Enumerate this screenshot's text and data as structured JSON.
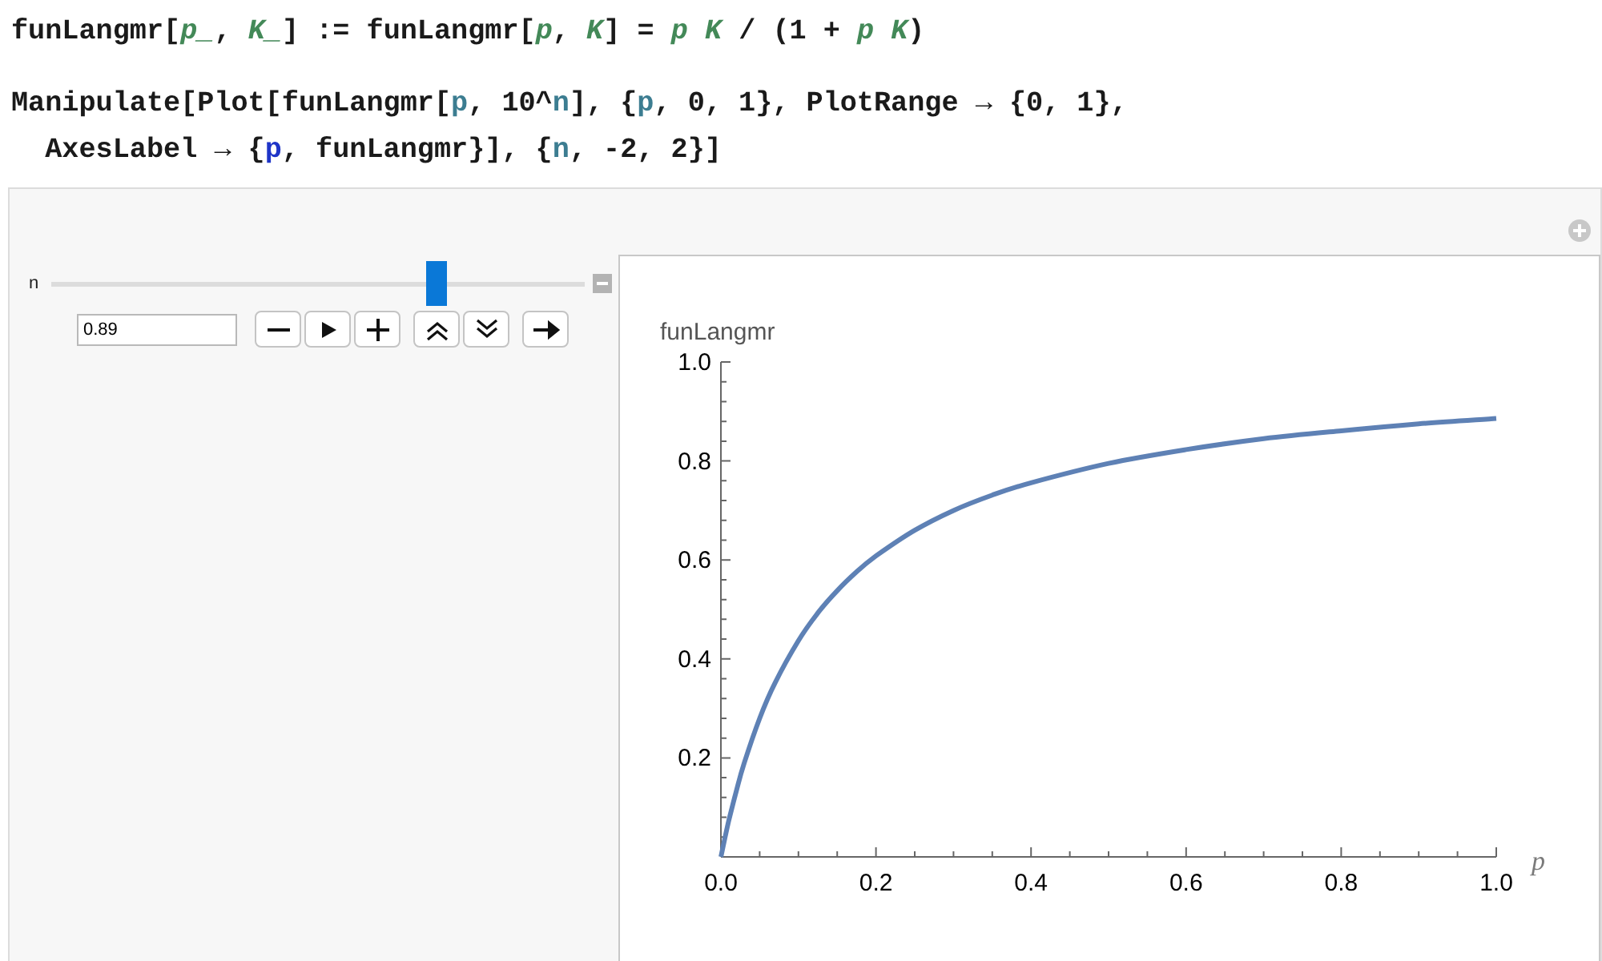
{
  "code_lines": [
    [
      {
        "t": "funLangmr[",
        "kind": "plain"
      },
      {
        "t": "p_",
        "kind": "pattern"
      },
      {
        "t": ", ",
        "kind": "plain"
      },
      {
        "t": "K_",
        "kind": "pattern"
      },
      {
        "t": "] := funLangmr[",
        "kind": "plain"
      },
      {
        "t": "p",
        "kind": "pattern"
      },
      {
        "t": ", ",
        "kind": "plain"
      },
      {
        "t": "K",
        "kind": "pattern"
      },
      {
        "t": "] = ",
        "kind": "plain"
      },
      {
        "t": "p K",
        "kind": "pattern"
      },
      {
        "t": " / (1 + ",
        "kind": "plain"
      },
      {
        "t": "p K",
        "kind": "pattern"
      },
      {
        "t": ")",
        "kind": "plain"
      }
    ],
    [
      {
        "t": "Manipulate[Plot[funLangmr[",
        "kind": "plain"
      },
      {
        "t": "p",
        "kind": "scoped"
      },
      {
        "t": ", 10^",
        "kind": "plain"
      },
      {
        "t": "n",
        "kind": "scoped"
      },
      {
        "t": "], {",
        "kind": "plain"
      },
      {
        "t": "p",
        "kind": "scoped"
      },
      {
        "t": ", 0, 1}, PlotRange → {0, 1},",
        "kind": "plain"
      }
    ],
    [
      {
        "t": "  AxesLabel → {",
        "kind": "plain"
      },
      {
        "t": "p",
        "kind": "unscoped"
      },
      {
        "t": ", funLangmr}], {",
        "kind": "plain"
      },
      {
        "t": "n",
        "kind": "scoped"
      },
      {
        "t": ", -2, 2}]",
        "kind": "plain"
      }
    ]
  ],
  "manipulate": {
    "slider": {
      "label": "n",
      "level": 0.72,
      "value": "0.89"
    },
    "controls": [
      {
        "kind": "minus"
      },
      {
        "kind": "play"
      },
      {
        "kind": "plus"
      },
      {
        "kind": "faster"
      },
      {
        "kind": "slower"
      },
      {
        "kind": "direction"
      }
    ],
    "plot": {
      "chart_data": {
        "type": "line",
        "xlabel": "p",
        "ylabel": "funLangmr",
        "x": [
          0,
          0.01,
          0.02,
          0.03,
          0.05,
          0.07,
          0.1,
          0.125,
          0.15,
          0.175,
          0.2,
          0.25,
          0.3,
          0.35,
          0.4,
          0.5,
          0.6,
          0.7,
          0.8,
          0.9,
          1.0
        ],
        "series": [
          {
            "color": "#5e81b5",
            "values": [
              0,
              0.072,
              0.134,
              0.189,
              0.28,
              0.352,
              0.437,
              0.493,
              0.538,
              0.576,
              0.608,
              0.66,
              0.7,
              0.731,
              0.756,
              0.795,
              0.823,
              0.845,
              0.861,
              0.875,
              0.886
            ]
          }
        ],
        "xlim": [
          0,
          1
        ],
        "ylim": [
          0,
          1
        ],
        "xticks": [
          {
            "value": 0,
            "label": "0.0"
          },
          {
            "value": 0.2,
            "label": "0.2"
          },
          {
            "value": 0.4,
            "label": "0.4"
          },
          {
            "value": 0.6,
            "label": "0.6"
          },
          {
            "value": 0.8,
            "label": "0.8"
          },
          {
            "value": 1,
            "label": "1.0"
          }
        ],
        "yticks": [
          {
            "value": 0.2,
            "label": "0.2"
          },
          {
            "value": 0.4,
            "label": "0.4"
          },
          {
            "value": 0.6,
            "label": "0.6"
          },
          {
            "value": 0.8,
            "label": "0.8"
          },
          {
            "value": 1,
            "label": "1.0"
          }
        ]
      }
    }
  }
}
